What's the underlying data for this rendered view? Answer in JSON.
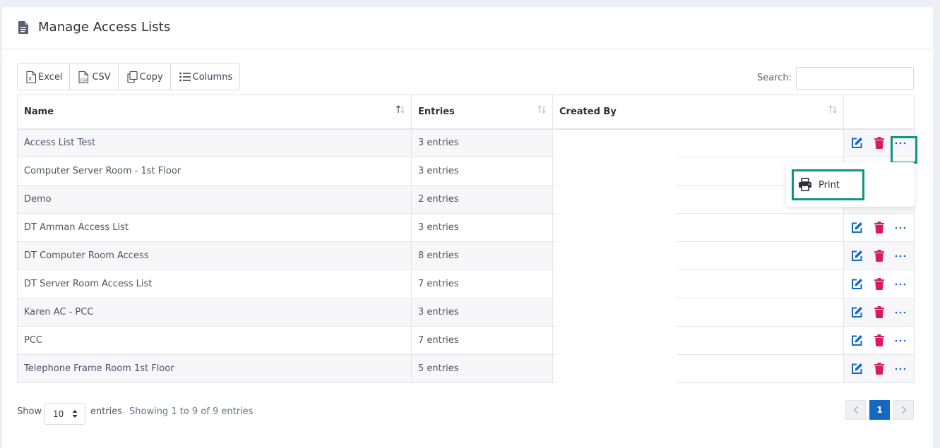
{
  "page": {
    "title": "Manage Access Lists"
  },
  "toolbar": {
    "buttons": [
      {
        "label": "Excel",
        "icon": "excel-file-icon"
      },
      {
        "label": "CSV",
        "icon": "csv-file-icon"
      },
      {
        "label": "Copy",
        "icon": "copy-icon"
      },
      {
        "label": "Columns",
        "icon": "list-icon"
      }
    ]
  },
  "search": {
    "label": "Search:",
    "value": ""
  },
  "table": {
    "headers": {
      "name": "Name",
      "entries": "Entries",
      "created_by": "Created By"
    },
    "rows": [
      {
        "name": "Access List Test",
        "entries": "3 entries"
      },
      {
        "name": "Computer Server Room - 1st Floor",
        "entries": "3 entries"
      },
      {
        "name": "Demo",
        "entries": "2 entries"
      },
      {
        "name": "DT Amman Access List",
        "entries": "3 entries"
      },
      {
        "name": "DT Computer Room Access",
        "entries": "8 entries"
      },
      {
        "name": "DT Server Room Access List",
        "entries": "7 entries"
      },
      {
        "name": "Karen AC - PCC",
        "entries": "3 entries"
      },
      {
        "name": "PCC",
        "entries": "7 entries"
      },
      {
        "name": "Telephone Frame Room 1st Floor",
        "entries": "5 entries"
      }
    ]
  },
  "dropdown": {
    "item_label": "Print",
    "item_icon": "printer-icon"
  },
  "footer": {
    "show_label": "Show",
    "page_size": "10",
    "entries_label": "entries",
    "info": "Showing 1 to 9 of 9 entries"
  },
  "pagination": {
    "current_page": "1"
  },
  "colors": {
    "edit": "#1669c3",
    "delete": "#d81b60",
    "highlight": "#0e9582",
    "active_page": "#1669c3"
  }
}
